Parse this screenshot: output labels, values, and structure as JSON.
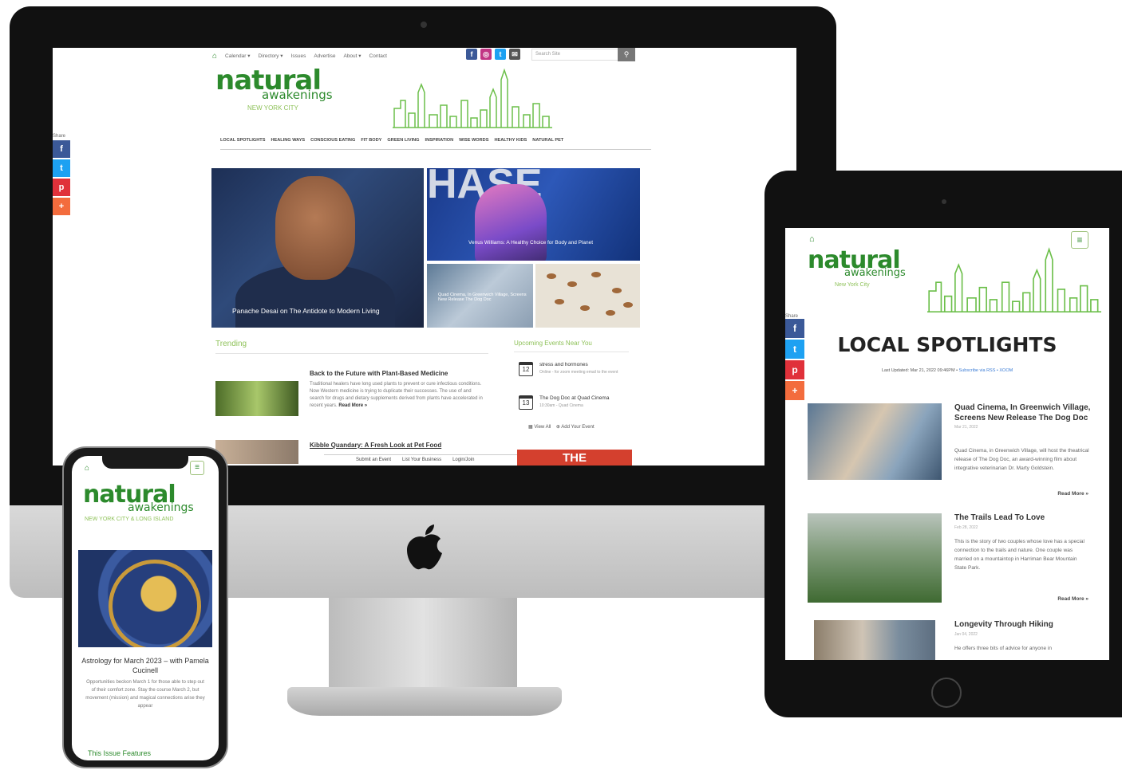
{
  "desktop": {
    "top_nav": [
      "Calendar ▾",
      "Directory ▾",
      "Issues",
      "Advertise",
      "About ▾",
      "Contact"
    ],
    "search": {
      "placeholder": "Search Site"
    },
    "logo": {
      "main": "natural",
      "sub": "awakenings",
      "tagline": "NEW YORK CITY"
    },
    "category_nav": [
      "LOCAL SPOTLIGHTS",
      "HEALING WAYS",
      "CONSCIOUS EATING",
      "FIT BODY",
      "GREEN LIVING",
      "INSPIRATION",
      "WISE WORDS",
      "HEALTHY KIDS",
      "NATURAL PET"
    ],
    "share_label": "Share",
    "hero": {
      "main_caption": "Panache Desai on The Antidote to Modern Living",
      "top_right_text": "HASE",
      "top_right_caption": "Venus Williams: A Healthy Choice for Body and Planet",
      "bottom_left_caption": "Quad Cinema, In Greenwich Village, Screens New Release The Dog Doc"
    },
    "trending_heading": "Trending",
    "article1": {
      "title": "Back to the Future with Plant-Based Medicine",
      "body": "Traditional healers have long used plants to prevent or cure infectious conditions. Now Western medicine is trying to duplicate their successes. The use of and search for drugs and dietary supplements derived from plants have accelerated in recent years.",
      "read_more": "Read More »"
    },
    "article2": {
      "title": "Kibble Quandary: A Fresh Look at Pet Food"
    },
    "events_heading": "Upcoming Events Near You",
    "events": [
      {
        "day": "12",
        "title": "stress and hormones",
        "sub": "Online - for zoom meeting email to the event"
      },
      {
        "day": "13",
        "title": "The Dog Doc at Quad Cinema",
        "sub": "10:30am - Quad Cinema"
      }
    ],
    "event_links": [
      "▦ View All",
      "⊕ Add Your Event"
    ],
    "bottom_bar": [
      "Submit an Event",
      "List Your Business",
      "Login/Join"
    ],
    "promo_text": "THE"
  },
  "tablet": {
    "page_title": "LOCAL SPOTLIGHTS",
    "logo": {
      "main": "natural",
      "sub": "awakenings",
      "tagline": "New York City"
    },
    "share_label": "Share",
    "updated_prefix": "Last Updated: Mar 21, 2022 09:46PM •",
    "updated_link": "Subscribe via RSS • XOOM",
    "articles": [
      {
        "title": "Quad Cinema, In Greenwich Village, Screens New Release The Dog Doc",
        "date": "Mar 21, 2022",
        "body": "Quad Cinema, in Greenwich Village, will host the theatrical release of The Dog Doc, an award-winning film about integrative veterinarian Dr. Marty Goldstein.",
        "read_more": "Read More »"
      },
      {
        "title": "The Trails Lead To Love",
        "date": "Feb 28, 2022",
        "body": "This is the story of two couples whose love has a special connection to the trails and nature. One couple was married on a mountaintop in Harriman Bear Mountain State Park.",
        "read_more": "Read More »"
      },
      {
        "title": "Longevity Through Hiking",
        "date": "Jan 04, 2022",
        "body": "He offers three bits of advice for anyone in"
      }
    ]
  },
  "phone": {
    "logo": {
      "main": "natural",
      "sub": "awakenings",
      "tagline": "NEW YORK CITY & LONG ISLAND"
    },
    "article": {
      "title": "Astrology for March 2023 – with Pamela Cucinell",
      "body": "Opportunities beckon March 1 for those able to step out of their comfort zone. Stay the course March 2, but movement (mission) and magical connections arise they appear"
    },
    "section_heading": "This Issue Features"
  },
  "colors": {
    "brand_green": "#2c8a2c",
    "light_green": "#8fc25a",
    "facebook": "#3b5998",
    "twitter": "#1da1f2",
    "pinterest": "#e0313a",
    "plus": "#f36c3d",
    "promo_red": "#d4402e"
  }
}
